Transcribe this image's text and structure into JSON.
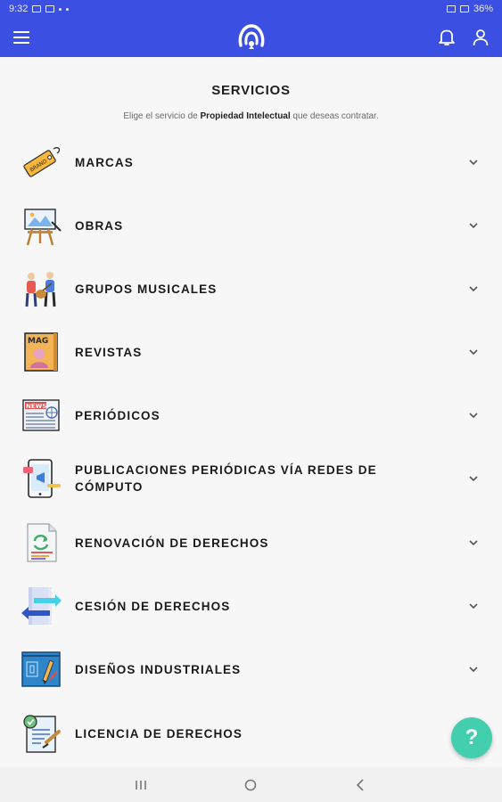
{
  "status_bar": {
    "time": "9:32",
    "battery": "36%"
  },
  "header": {
    "title": "SERVICIOS"
  },
  "subtitle": {
    "before": "Elige el servicio de ",
    "bold": "Propiedad Intelectual",
    "after": " que deseas contratar."
  },
  "services": [
    {
      "label": "MARCAS",
      "icon": "price-tag-icon"
    },
    {
      "label": "OBRAS",
      "icon": "easel-painting-icon"
    },
    {
      "label": "GRUPOS MUSICALES",
      "icon": "music-band-icon"
    },
    {
      "label": "REVISTAS",
      "icon": "magazine-icon"
    },
    {
      "label": "PERIÓDICOS",
      "icon": "newspaper-icon"
    },
    {
      "label": "PUBLICACIONES PERIÓDICAS VÍA REDES DE CÓMPUTO",
      "icon": "tablet-publication-icon"
    },
    {
      "label": "RENOVACIÓN DE DERECHOS",
      "icon": "recycle-document-icon"
    },
    {
      "label": "CESIÓN DE DERECHOS",
      "icon": "transfer-arrows-icon"
    },
    {
      "label": "DISEÑOS INDUSTRIALES",
      "icon": "blueprint-design-icon"
    },
    {
      "label": "LICENCIA DE DERECHOS",
      "icon": "license-document-icon"
    }
  ],
  "help": {
    "label": "?"
  },
  "colors": {
    "primary": "#3b4fe3",
    "accent": "#43cfae"
  }
}
